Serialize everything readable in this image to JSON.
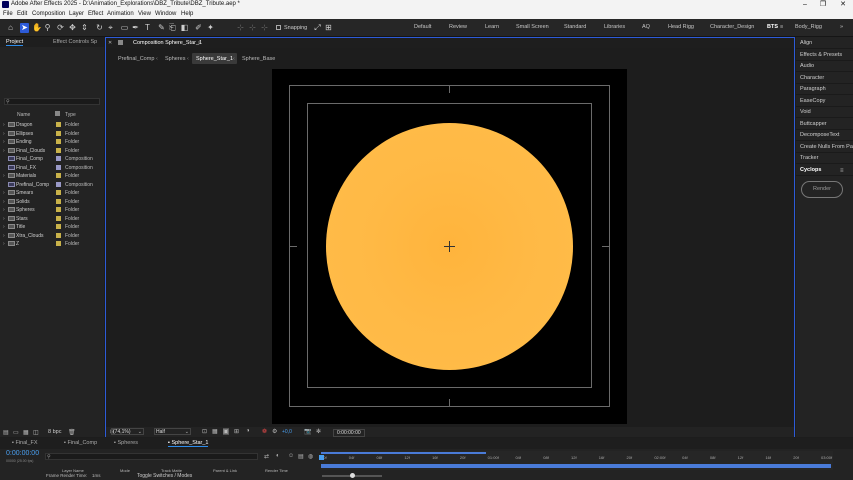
{
  "app": {
    "title": "Adobe After Effects 2025 - D:\\Animation_Explorations\\DBZ_Tribute\\DBZ_Tribute.aep *"
  },
  "window_controls": {
    "minimize": "–",
    "maximize": "❐",
    "close": "✕"
  },
  "menu": [
    "File",
    "Edit",
    "Composition",
    "Layer",
    "Effect",
    "Animation",
    "View",
    "Window",
    "Help"
  ],
  "toolbar": {
    "snapping_label": "Snapping"
  },
  "workspaces": [
    "Default",
    "Review",
    "Learn",
    "Small Screen",
    "Standard",
    "Libraries",
    "AQ",
    "Head Rigg",
    "Character_Design",
    "BTS",
    "Body_Rigg"
  ],
  "workspace_active": "BTS",
  "project_panel": {
    "tabs": [
      "Project",
      "Effect Controls Sp"
    ],
    "search_placeholder": "",
    "col_name": "Name",
    "col_type": "Type",
    "items": [
      {
        "name": "Dragon",
        "type": "Folder",
        "kind": "folder"
      },
      {
        "name": "Ellipses",
        "type": "Folder",
        "kind": "folder"
      },
      {
        "name": "Ending",
        "type": "Folder",
        "kind": "folder"
      },
      {
        "name": "Final_Clouds",
        "type": "Folder",
        "kind": "folder"
      },
      {
        "name": "Final_Comp",
        "type": "Composition",
        "kind": "comp"
      },
      {
        "name": "Final_FX",
        "type": "Composition",
        "kind": "comp"
      },
      {
        "name": "Materials",
        "type": "Folder",
        "kind": "folder"
      },
      {
        "name": "Prefinal_Comp",
        "type": "Composition",
        "kind": "comp"
      },
      {
        "name": "Smears",
        "type": "Folder",
        "kind": "folder"
      },
      {
        "name": "Solids",
        "type": "Folder",
        "kind": "folder"
      },
      {
        "name": "Spheres",
        "type": "Folder",
        "kind": "folder"
      },
      {
        "name": "Stars",
        "type": "Folder",
        "kind": "folder"
      },
      {
        "name": "Title",
        "type": "Folder",
        "kind": "folder"
      },
      {
        "name": "Xtra_Clouds",
        "type": "Folder",
        "kind": "folder"
      },
      {
        "name": "Z",
        "type": "Folder",
        "kind": "folder"
      }
    ],
    "bpc": "8 bpc"
  },
  "comp_panel": {
    "tab": "Composition Sphere_Star_1",
    "breadcrumbs": [
      "Prefinal_Comp",
      "Spheres",
      "Sphere_Star_1",
      "Sphere_Base"
    ],
    "active_breadcrumb": "Sphere_Star_1",
    "zoom": "(74,1%)",
    "resolution": "Half",
    "exposure": "+0,0",
    "timecode": "0:00:00:00",
    "sphere_color": "#ffb43c"
  },
  "right_panel": {
    "items": [
      "Align",
      "Effects & Presets",
      "Audio",
      "Character",
      "Paragraph",
      "EaseCopy",
      "Void",
      "Buttcapper",
      "DecomposeText",
      "Create Nulls From Pa",
      "Tracker",
      "Cyclops"
    ],
    "render_label": "Render"
  },
  "timeline": {
    "tabs": [
      "Final_FX",
      "Final_Comp",
      "Spheres",
      "Sphere_Star_1"
    ],
    "active_tab": "Sphere_Star_1",
    "timecode": "0:00:00:00",
    "subcode": "00000 (25.00 fps)",
    "columns": [
      "Layer Name",
      "Mode",
      "Track Matte",
      "Parent & Link",
      "Render Time"
    ],
    "ruler": [
      "00f",
      "04f",
      "08f",
      "12f",
      "16f",
      "20f",
      "01:00f",
      "04f",
      "08f",
      "12f",
      "16f",
      "20f",
      "02:00f",
      "04f",
      "08f",
      "12f",
      "16f",
      "20f",
      "03:00f"
    ],
    "footer_left": "Frame Render Time:",
    "footer_left_val": "1ms",
    "footer_center": "Toggle Switches / Modes"
  }
}
